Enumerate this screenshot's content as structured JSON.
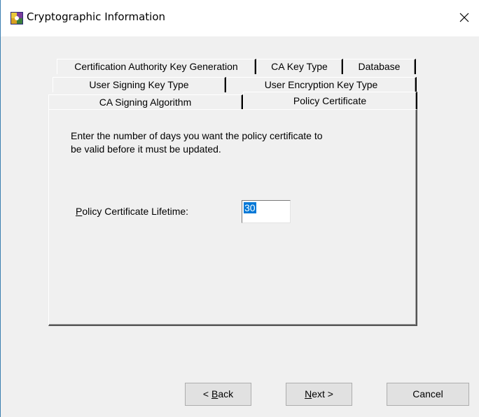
{
  "window": {
    "title": "Cryptographic Information"
  },
  "tabs": [
    {
      "label": "Certification Authority Key Generation"
    },
    {
      "label": "CA Key Type"
    },
    {
      "label": "Database"
    },
    {
      "label": "User Signing Key Type"
    },
    {
      "label": "User Encryption Key Type"
    },
    {
      "label": "CA Signing Algorithm"
    },
    {
      "label": "Policy Certificate",
      "active": true
    }
  ],
  "panel": {
    "description": "Enter the number of days you want the policy certificate to be valid before it must be updated.",
    "lifetime_label_mnemonic": "P",
    "lifetime_label_rest": "olicy Certificate Lifetime:",
    "lifetime_value": "30"
  },
  "buttons": {
    "back_prefix": "< ",
    "back_mnemonic": "B",
    "back_rest": "ack",
    "next_mnemonic": "N",
    "next_rest": "ext >",
    "cancel": "Cancel"
  }
}
